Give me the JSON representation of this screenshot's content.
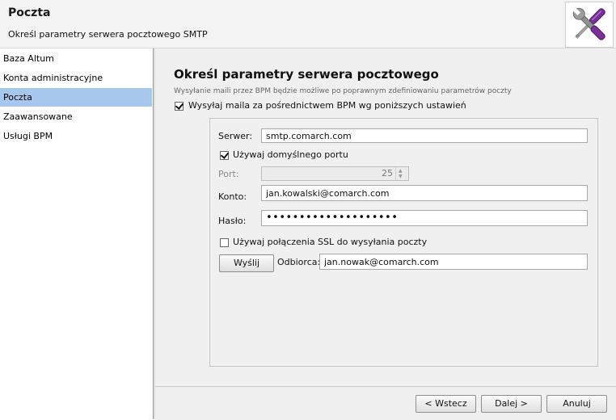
{
  "header": {
    "title": "Poczta",
    "subtitle": "Określ parametry serwera pocztowego SMTP",
    "logo_icon": "tools-icon"
  },
  "sidebar": {
    "items": [
      {
        "label": "Baza Altum",
        "selected": false
      },
      {
        "label": "Konta administracyjne",
        "selected": false
      },
      {
        "label": "Poczta",
        "selected": true
      },
      {
        "label": "Zaawansowane",
        "selected": false
      },
      {
        "label": "Usługi BPM",
        "selected": false
      }
    ]
  },
  "main": {
    "title": "Określ parametry serwera pocztowego",
    "description": "Wysyłanie maili przez BPM będzie możliwe po poprawnym zdefiniowaniu parametrów poczty",
    "send_via_bpm": {
      "label": "Wysyłaj maila za pośrednictwem BPM wg poniższych ustawień",
      "checked": true
    },
    "server": {
      "label": "Serwer:",
      "value": "smtp.comarch.com"
    },
    "default_port": {
      "label": "Używaj domyślnego portu",
      "checked": true
    },
    "port": {
      "label": "Port:",
      "value": "25"
    },
    "account": {
      "label": "Konto:",
      "value": "jan.kowalski@comarch.com"
    },
    "password": {
      "label": "Hasło:",
      "value": "••••••••••••••••••••"
    },
    "ssl": {
      "label": "Używaj połączenia SSL do wysyłania poczty",
      "checked": false
    },
    "send_button": "Wyślij",
    "recipient": {
      "label": "Odbiorca:",
      "value": "jan.nowak@comarch.com"
    }
  },
  "footer": {
    "back_label": "< Wstecz",
    "next_label": "Dalej >",
    "cancel_label": "Anuluj"
  }
}
